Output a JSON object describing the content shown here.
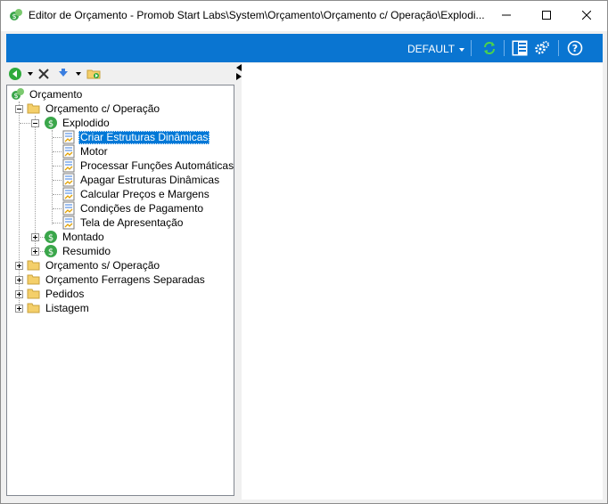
{
  "window": {
    "title": "Editor de Orçamento - Promob Start Labs\\System\\Orçamento\\Orçamento c/ Operação\\Explodi..."
  },
  "toolbar": {
    "profile_label": "DEFAULT",
    "buttons": [
      "refresh-icon",
      "panel-layout-icon",
      "settings-gears-icon",
      "help-icon"
    ]
  },
  "tree_toolbar": {
    "buttons": [
      "add-icon",
      "delete-icon",
      "move-down-icon",
      "open-folder-icon"
    ]
  },
  "tree": {
    "root": "Orçamento",
    "orcamento_com_operacao": "Orçamento c/ Operação",
    "explodido": "Explodido",
    "explodido_children": [
      "Criar Estruturas Dinâmicas",
      "Motor",
      "Processar Funções Automáticas",
      "Apagar Estruturas Dinâmicas",
      "Calcular Preços e Margens",
      "Condições de Pagamento",
      "Tela de Apresentação"
    ],
    "montado": "Montado",
    "resumido": "Resumido",
    "orcamento_sem_operacao": "Orçamento s/ Operação",
    "ferragens": "Orçamento Ferragens Separadas",
    "pedidos": "Pedidos",
    "listagem": "Listagem",
    "selected": "Criar Estruturas Dinâmicas"
  },
  "colors": {
    "accent": "#0a75d1",
    "selection": "#0078d7",
    "folder": "#f4cf6a",
    "money_green": "#3aa64a"
  }
}
